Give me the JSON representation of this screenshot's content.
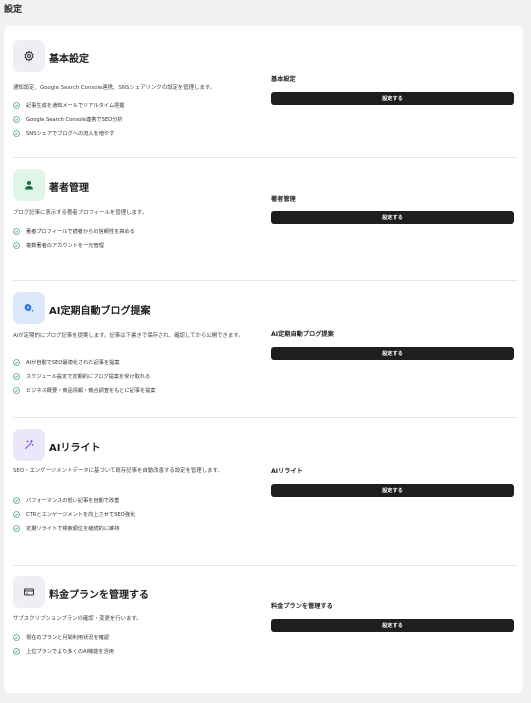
{
  "page": {
    "title": "設定"
  },
  "colors": {
    "check": "#3d9a5e",
    "button_bg": "#1e1e1e"
  },
  "sections": [
    {
      "icon": "gear-icon",
      "title": "基本設定",
      "description": "通知設定、Google Search Console連携、SNSシェアリンクの設定を管理します。",
      "features": [
        "記事生成を通知メールでリアルタイム把握",
        "Google Search Console連携でSEO分析",
        "SNSシェアでブログへの流入を増やす"
      ],
      "right_label": "基本設定",
      "button_label": "設定する"
    },
    {
      "icon": "user-icon",
      "title": "著者管理",
      "description": "ブログ記事に表示する著者プロフィールを管理します。",
      "features": [
        "著者プロフィールで読者からの信頼性を高める",
        "複数著者のアカウントを一元管理"
      ],
      "right_label": "著者管理",
      "button_label": "設定する"
    },
    {
      "icon": "gear-sparkle-icon",
      "title": "AI定期自動ブログ提案",
      "description": "AIが定期的にブログ記事を提案します。記事は下書きで保存され、確認してから公開できます。",
      "features": [
        "AIが自動でSEO最適化された記事を提案",
        "スケジュール設定で定期的にブログ提案を受け取れる",
        "ビジネス概要・商品情報・競合調査をもとに記事を提案"
      ],
      "right_label": "AI定期自動ブログ提案",
      "button_label": "設定する"
    },
    {
      "icon": "magic-wand-icon",
      "title": "AIリライト",
      "description": "SEO・エンゲージメントデータに基づいて既存記事を自動改善する設定を管理します。",
      "features": [
        "パフォーマンスの低い記事を自動で改善",
        "CTRとエンゲージメントを向上させてSEO強化",
        "定期リライトで検索順位を継続的に維持"
      ],
      "right_label": "AIリライト",
      "button_label": "設定する"
    },
    {
      "icon": "credit-card-icon",
      "title": "料金プランを管理する",
      "description": "サブスクリプションプランの確認・変更を行います。",
      "features": [
        "現在のプランと月間利用状況を確認",
        "上位プランでより多くのAI機能を活用"
      ],
      "right_label": "料金プランを管理する",
      "button_label": "設定する"
    }
  ]
}
